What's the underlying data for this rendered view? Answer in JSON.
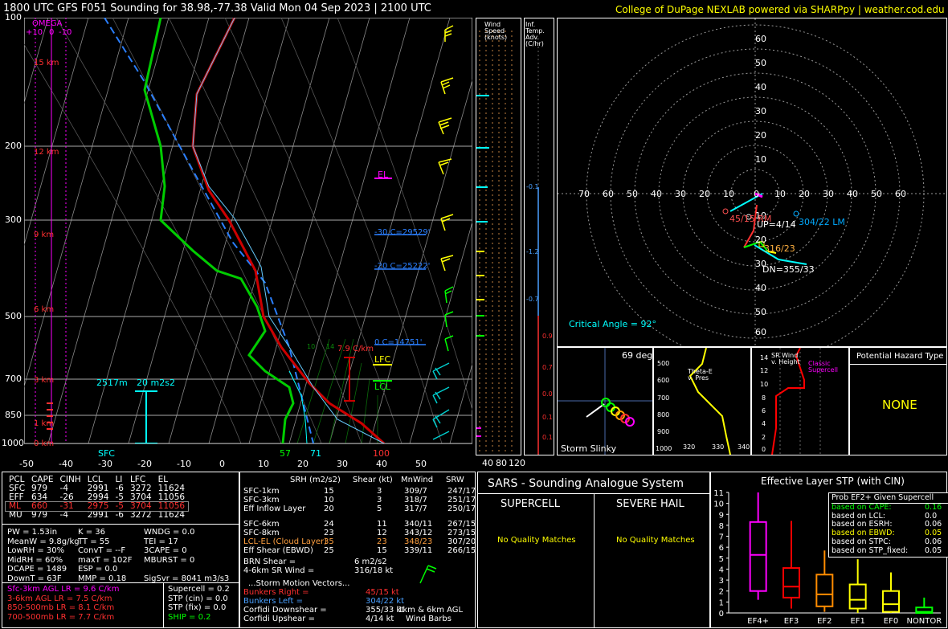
{
  "header": {
    "title": "1800 UTC GFS F051 Sounding for 38.98,-77.38 Valid  Mon 04 Sep 2023 | 2100 UTC",
    "credit": "College of DuPage NEXLAB powered via SHARPpy | weather.cod.edu"
  },
  "skewt": {
    "omega_label": "OMEGA",
    "omega_ticks": [
      "+10",
      "0",
      "-10"
    ],
    "pressure_ticks": [
      "100",
      "200",
      "300",
      "500",
      "700",
      "850",
      "1000"
    ],
    "temp_ticks": [
      "-50",
      "-40",
      "-30",
      "-20",
      "-10",
      "0",
      "10",
      "20",
      "30",
      "40",
      "50"
    ],
    "height_labels": [
      "15 km",
      "12 km",
      "9 km",
      "6 km",
      "3 km",
      "1 km",
      "0 km"
    ],
    "el_label": "EL",
    "lfc_label": "LFC",
    "lcl_label": "LCL",
    "isotherm_labels": [
      "-30 C=29529'",
      "-20 C=25222'",
      "0 C=14751'"
    ],
    "lapse_label": "7.9 C/km",
    "srh_box_height": "2517m",
    "srh_box_value": "20 m2s2",
    "sfc_label": "SFC",
    "sfc_td": "57",
    "sfc_t": "71",
    "sfc_100": "100",
    "mixing_ratio_labels": [
      "10",
      "14"
    ]
  },
  "wind_panel": {
    "title": "Wind Speed (knots)",
    "ticks": [
      "40",
      "80",
      "120"
    ]
  },
  "adv_panel": {
    "title": "Inf. Temp. Adv. (C/hr)",
    "values": [
      "-0.1",
      "-1.2",
      "-0.7",
      "0.9",
      "0.7",
      "0.0",
      "0.1",
      "0.1"
    ]
  },
  "hodograph": {
    "rings_right": [
      "10",
      "20",
      "30",
      "40",
      "50",
      "60"
    ],
    "rings_left": [
      "70",
      "60",
      "50",
      "40",
      "30",
      "20",
      "10"
    ],
    "rings_up": [
      "60",
      "50",
      "40",
      "30",
      "20",
      "10"
    ],
    "rings_down": [
      "10",
      "20",
      "30",
      "40",
      "50",
      "60"
    ],
    "zero": "0",
    "bunkers_right": "45/15 RM",
    "bunkers_left": "304/22 LM",
    "upshear": "UP=4/14",
    "mean_wind": "316/23",
    "downshear": "DN=355/33",
    "critical_angle": "Critical Angle = 92°"
  },
  "slinky": {
    "angle": "69 deg",
    "title": "Storm Slinky"
  },
  "thetae": {
    "title": "Theta-E v. Pres",
    "pres_ticks": [
      "500",
      "600",
      "700",
      "800",
      "900",
      "1000"
    ],
    "x_ticks": [
      "320",
      "330",
      "340"
    ]
  },
  "srwind": {
    "title": "SR Wind v. Height",
    "h_ticks": [
      "14",
      "12",
      "10",
      "8",
      "6",
      "4",
      "2",
      "0"
    ],
    "tag": "Classic Supercell"
  },
  "hazard": {
    "title": "Potential Hazard Type",
    "value": "NONE"
  },
  "parcels": {
    "headers": [
      "PCL",
      "CAPE",
      "CINH",
      "LCL",
      "LI",
      "LFC",
      "EL"
    ],
    "rows": [
      [
        "SFC",
        "979",
        "-4",
        "2991",
        "-6",
        "3272",
        "11624"
      ],
      [
        "EFF",
        "634",
        "-26",
        "2994",
        "-5",
        "3704",
        "11056"
      ],
      [
        "ML",
        "660",
        "-31",
        "2975",
        "-5",
        "3704",
        "11056"
      ],
      [
        "MU",
        "979",
        "-4",
        "2991",
        "-6",
        "3272",
        "11624"
      ]
    ]
  },
  "indices": {
    "col1": [
      "PW = 1.53in",
      "MeanW = 9.8g/kg",
      "LowRH = 30%",
      "MidRH = 60%",
      "DCAPE = 1489",
      "DownT = 63F"
    ],
    "col2": [
      "K = 36",
      "TT = 55",
      "ConvT = --F",
      "maxT = 102F",
      "ESP = 0.0",
      "MMP = 0.18"
    ],
    "col3": [
      "WNDG = 0.0",
      "TEI = 17",
      "3CAPE = 0",
      "MBURST = 0",
      "",
      "SigSvr = 8041 m3/s3"
    ]
  },
  "lapse": [
    "Sfc-3km AGL LR = 9.6 C/km",
    "3-6km AGL LR = 7.5 C/km",
    "850-500mb LR = 8.1 C/km",
    "700-500mb LR = 7.7 C/km"
  ],
  "composites": [
    "Supercell = 0.2",
    "STP (cin) = 0.0",
    "STP (fix) = 0.0",
    "SHIP = 0.2"
  ],
  "kinematics": {
    "headers": [
      "SRH (m2/s2)",
      "Shear (kt)",
      "MnWind",
      "SRW"
    ],
    "rows": [
      [
        "SFC-1km",
        "15",
        "3",
        "309/7",
        "247/17"
      ],
      [
        "SFC-3km",
        "10",
        "3",
        "318/7",
        "251/17"
      ],
      [
        "Eff Inflow Layer",
        "20",
        "5",
        "317/7",
        "250/17"
      ],
      [
        "",
        "",
        "",
        "",
        ""
      ],
      [
        "SFC-6km",
        "24",
        "11",
        "340/11",
        "267/15"
      ],
      [
        "SFC-8km",
        "23",
        "12",
        "343/12",
        "273/15"
      ],
      [
        "LCL-EL (Cloud Layer)",
        "35",
        "23",
        "348/23",
        "307/20"
      ],
      [
        "Eff Shear (EBWD)",
        "25",
        "15",
        "339/11",
        "266/15"
      ]
    ],
    "brn_shear": "BRN Shear =",
    "brn_shear_val": "6 m2/s2",
    "sr_wind": "4-6km SR Wind =",
    "sr_wind_val": "316/18 kt",
    "storm_motion": "...Storm Motion Vectors...",
    "motions": [
      [
        "Bunkers Right =",
        "45/15 kt"
      ],
      [
        "Bunkers Left =",
        "304/22 kt"
      ],
      [
        "Corfidi Downshear =",
        "355/33 kt"
      ],
      [
        "Corfidi Upshear =",
        "4/14 kt"
      ]
    ],
    "barb_label_1": "1km & 6km AGL",
    "barb_label_2": "Wind Barbs"
  },
  "sars": {
    "title": "SARS - Sounding Analogue System",
    "supercell": "SUPERCELL",
    "hail": "SEVERE HAIL",
    "supercell_result": "No Quality Matches",
    "hail_result": "No Quality Matches"
  },
  "chart_data": {
    "type": "box",
    "title": "Effective Layer STP (with CIN)",
    "categories": [
      "EF4+",
      "EF3",
      "EF2",
      "EF1",
      "EF0",
      "NONTOR"
    ],
    "y_ticks": [
      "0",
      "1",
      "2",
      "3",
      "4",
      "5",
      "6",
      "7",
      "8",
      "9",
      "10",
      "11"
    ],
    "ylim": [
      0,
      11
    ],
    "colors": [
      "#ff00ff",
      "#ff0000",
      "#ff8c00",
      "#ffff00",
      "#ffff00",
      "#00ff00"
    ],
    "boxes": [
      {
        "whisker_low": 1.2,
        "q1": 2.0,
        "median": 5.3,
        "q3": 8.3,
        "whisker_high": 11.0
      },
      {
        "whisker_low": 0.4,
        "q1": 1.4,
        "median": 2.4,
        "q3": 4.1,
        "whisker_high": 8.4
      },
      {
        "whisker_low": 0.1,
        "q1": 0.6,
        "median": 1.7,
        "q3": 3.5,
        "whisker_high": 5.7
      },
      {
        "whisker_low": 0.0,
        "q1": 0.4,
        "median": 1.2,
        "q3": 2.6,
        "whisker_high": 4.9
      },
      {
        "whisker_low": 0.0,
        "q1": 0.1,
        "median": 0.8,
        "q3": 2.0,
        "whisker_high": 3.7
      },
      {
        "whisker_low": 0.0,
        "q1": 0.0,
        "median": 0.1,
        "q3": 0.5,
        "whisker_high": 1.4
      }
    ],
    "legend": {
      "title": "Prob EF2+ Given Supercell",
      "rows": [
        [
          "based on CAPE:",
          "0.16"
        ],
        [
          "based on LCL:",
          "0.0"
        ],
        [
          "based on ESRH:",
          "0.06"
        ],
        [
          "based on EBWD:",
          "0.05"
        ],
        [
          "based on STPC:",
          "0.06"
        ],
        [
          "based on STP_fixed:",
          "0.05"
        ]
      ]
    }
  }
}
